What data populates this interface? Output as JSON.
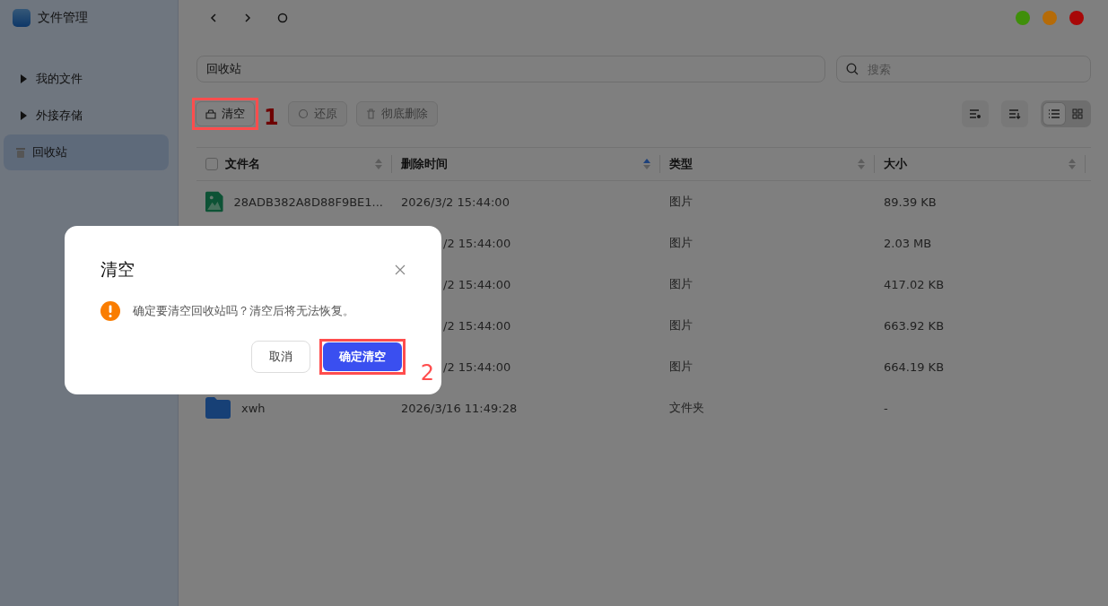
{
  "app": {
    "title": "文件管理"
  },
  "window_controls": [
    {
      "color": "#3f8f0a"
    },
    {
      "color": "#b56b08"
    },
    {
      "color": "#a80808"
    }
  ],
  "sidebar": {
    "items": [
      {
        "label": "我的文件",
        "kind": "folder",
        "selected": false
      },
      {
        "label": "外接存储",
        "kind": "folder",
        "selected": false
      },
      {
        "label": "回收站",
        "kind": "trash",
        "selected": true
      }
    ]
  },
  "path": "回收站",
  "search": {
    "placeholder": "搜索"
  },
  "toolbar": [
    {
      "label": "清空",
      "kind": "clear",
      "disabled": false,
      "annotation": "1"
    },
    {
      "label": "还原",
      "kind": "restore",
      "disabled": true
    },
    {
      "label": "彻底删除",
      "kind": "delete",
      "disabled": true
    }
  ],
  "view_modes": [
    {
      "kind": "list",
      "selected": true
    },
    {
      "kind": "grid",
      "selected": false
    }
  ],
  "table": {
    "columns": [
      {
        "label": "文件名",
        "sorted": false
      },
      {
        "label": "删除时间",
        "sorted": true
      },
      {
        "label": "类型",
        "sorted": false
      },
      {
        "label": "大小",
        "sorted": false
      }
    ],
    "rows": [
      {
        "kind": "image",
        "name": "28ADB382A8D88F9BE1...",
        "time": "2026/3/2 15:44:00",
        "type": "图片",
        "size": "89.39 KB"
      },
      {
        "kind": "hidden",
        "time": "/2 15:44:00",
        "type": "图片",
        "size": "2.03 MB"
      },
      {
        "kind": "hidden",
        "time": "/2 15:44:00",
        "type": "图片",
        "size": "417.02 KB"
      },
      {
        "kind": "hidden",
        "time": "/2 15:44:00",
        "type": "图片",
        "size": "663.92 KB"
      },
      {
        "kind": "hidden",
        "time": "/2 15:44:00",
        "type": "图片",
        "size": "664.19 KB"
      },
      {
        "kind": "folder",
        "name": "xwh",
        "time": "2026/3/16 11:49:28",
        "type": "文件夹",
        "size": "-"
      }
    ]
  },
  "dialog": {
    "title": "清空",
    "message": "确定要清空回收站吗？清空后将无法恢复。",
    "cancel": "取消",
    "confirm": "确定清空",
    "confirm_annotation": "2"
  }
}
